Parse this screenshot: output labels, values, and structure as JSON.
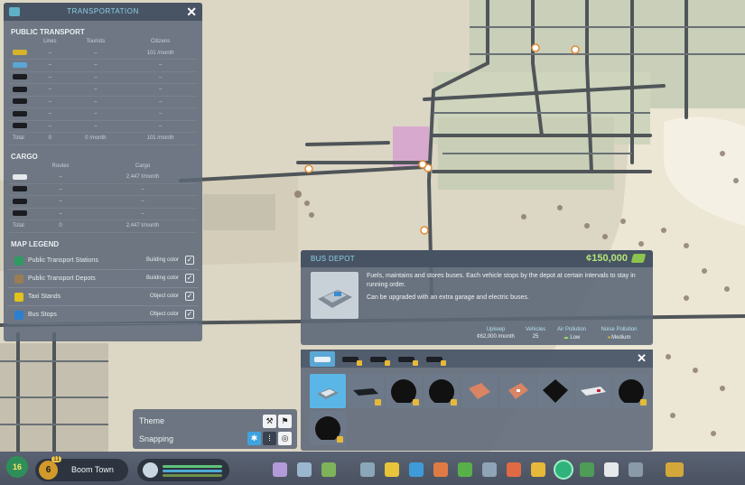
{
  "transport_panel": {
    "title": "TRANSPORTATION",
    "public_transport": {
      "heading": "PUBLIC TRANSPORT",
      "columns": [
        "Lines",
        "Tourists",
        "Citizens"
      ],
      "rows": [
        {
          "icon": "taxi-icon",
          "lines": "–",
          "tourists": "–",
          "citizens": "101 /month"
        },
        {
          "icon": "bus-icon",
          "lines": "–",
          "tourists": "–",
          "citizens": "–"
        },
        {
          "icon": "tram-icon",
          "lines": "–",
          "tourists": "–",
          "citizens": "–"
        },
        {
          "icon": "train-icon",
          "lines": "–",
          "tourists": "–",
          "citizens": "–"
        },
        {
          "icon": "subway-icon",
          "lines": "–",
          "tourists": "–",
          "citizens": "–"
        },
        {
          "icon": "ship-icon",
          "lines": "–",
          "tourists": "–",
          "citizens": "–"
        },
        {
          "icon": "airplane-icon",
          "lines": "–",
          "tourists": "–",
          "citizens": "–"
        }
      ],
      "total": {
        "label": "Total",
        "lines": "0",
        "tourists": "0 /month",
        "citizens": "101 /month"
      }
    },
    "cargo": {
      "heading": "CARGO",
      "columns": [
        "Routes",
        "Cargo"
      ],
      "rows": [
        {
          "icon": "truck-icon",
          "routes": "–",
          "cargo": "2,447 t/month"
        },
        {
          "icon": "cargo-train-icon",
          "routes": "–",
          "cargo": "–"
        },
        {
          "icon": "cargo-ship-icon",
          "routes": "–",
          "cargo": "–"
        },
        {
          "icon": "cargo-plane-icon",
          "routes": "–",
          "cargo": "–"
        }
      ],
      "total": {
        "label": "Total",
        "routes": "0",
        "cargo": "2,447 t/month"
      }
    },
    "legend": {
      "heading": "MAP LEGEND",
      "items": [
        {
          "label": "Public Transport Stations",
          "mode": "Building color",
          "color": "#2f9a62"
        },
        {
          "label": "Public Transport Depots",
          "mode": "Building color",
          "color": "#9a7d52"
        },
        {
          "label": "Taxi Stands",
          "mode": "Object color",
          "color": "#e3c21c"
        },
        {
          "label": "Bus Stops",
          "mode": "Object color",
          "color": "#2b7fd1"
        }
      ]
    }
  },
  "info_card": {
    "name": "BUS DEPOT",
    "cost": "¢150,000",
    "description": "Fuels, maintains and stores buses. Each vehicle stops by the depot at certain intervals to stay in running order.",
    "upgrade": "Can be upgraded with an extra garage and electric buses.",
    "stats": [
      {
        "label": "Upkeep",
        "value": "¢62,000 /month"
      },
      {
        "label": "Vehicles",
        "value": "25"
      },
      {
        "label": "Air Pollution",
        "value": "Low"
      },
      {
        "label": "Noise Pollution",
        "value": "Medium"
      }
    ]
  },
  "picker": {
    "tabs": [
      "bus",
      "train",
      "tram",
      "subway",
      "airplane"
    ],
    "tiles": [
      "bus-depot",
      "bus-station",
      "locked",
      "locked",
      "taxi-stand",
      "taxi-depot",
      "bus-terminal",
      "train-station",
      "locked",
      "locked"
    ]
  },
  "options": {
    "theme_label": "Theme",
    "snapping_label": "Snapping"
  },
  "bottom_bar": {
    "xp": "16",
    "level": "6",
    "city_name": "Boom Town",
    "milestone_badge": "11"
  },
  "colors": {
    "accent": "#5ab6e6",
    "money": "#b5e57a",
    "panel": "#5c6878"
  }
}
